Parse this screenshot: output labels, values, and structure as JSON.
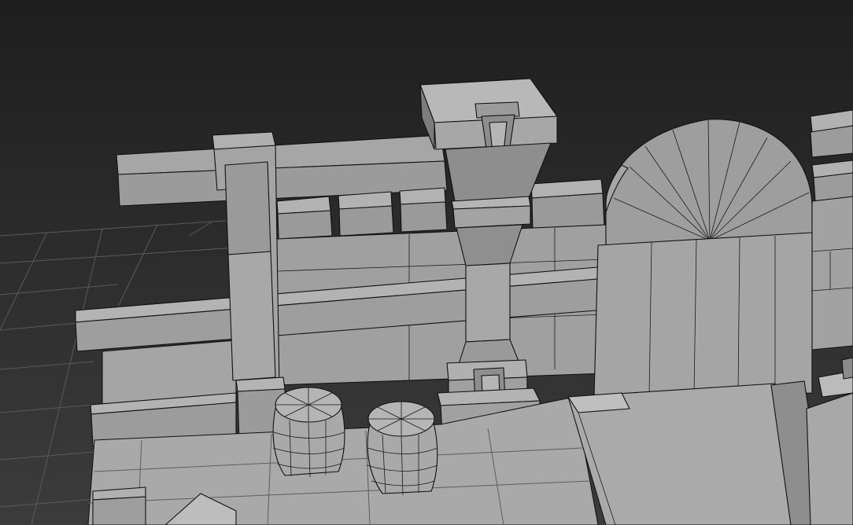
{
  "viewport": {
    "background_top": "#1e1e1e",
    "background_bottom": "#3c3c3c",
    "mesh_face": "#a3a3a3",
    "mesh_face_light": "#b0b0b0",
    "mesh_face_dark": "#8a8a8a",
    "mesh_face_shadow": "#707070",
    "wire_color": "#111111",
    "grid_color": "#5a5a5a"
  }
}
